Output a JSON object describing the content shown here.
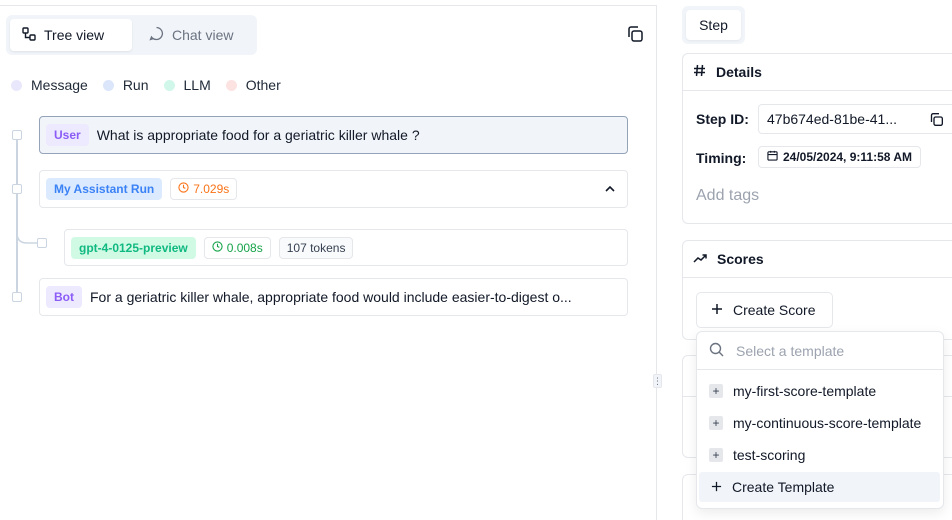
{
  "toggle": {
    "tree_label": "Tree view",
    "chat_label": "Chat view"
  },
  "legend": [
    {
      "label": "Message",
      "color": "#e9e7fb"
    },
    {
      "label": "Run",
      "color": "#dbe6fb"
    },
    {
      "label": "LLM",
      "color": "#d1f7ea"
    },
    {
      "label": "Other",
      "color": "#fde2e2"
    }
  ],
  "steps": {
    "user": {
      "badge": "User",
      "text": "What is appropriate food for a geriatric killer whale ?"
    },
    "run": {
      "badge": "My Assistant Run",
      "duration": "7.029s"
    },
    "llm": {
      "badge": "gpt-4-0125-preview",
      "duration": "0.008s",
      "tokens": "107 tokens"
    },
    "bot": {
      "badge": "Bot",
      "text": "For a geriatric killer whale, appropriate food would include easier-to-digest o..."
    }
  },
  "right": {
    "step_tab": "Step",
    "details_title": "Details",
    "step_id_label": "Step ID:",
    "step_id_value": "47b674ed-81be-41...",
    "timing_label": "Timing:",
    "timing_value": "24/05/2024, 9:11:58 AM",
    "add_tags_placeholder": "Add tags",
    "scores_title": "Scores",
    "create_score_label": "Create Score"
  },
  "dropdown": {
    "search_placeholder": "Select a template",
    "items": [
      "my-first-score-template",
      "my-continuous-score-template",
      "test-scoring"
    ],
    "create_label": "Create Template"
  },
  "colors": {
    "accent": "#3b82f6",
    "user_badge": "#8b5cf6",
    "llm_badge": "#10b981",
    "run_duration": "#f97316"
  }
}
